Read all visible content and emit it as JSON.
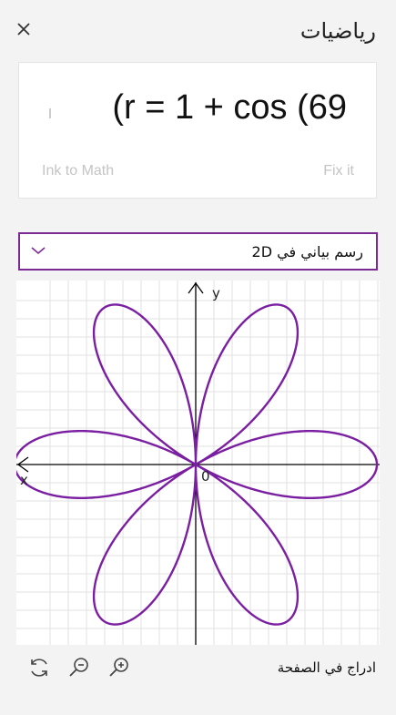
{
  "header": {
    "title": "رياضيات",
    "close_icon": "close-icon"
  },
  "equation": {
    "text": "(r = 1 + cos (69",
    "actions": {
      "fix_it": "Fix it",
      "ink_to_math": "Ink to Math"
    }
  },
  "graph_mode": {
    "selected": "رسم بياني في 2D",
    "chevron_icon": "chevron-down-icon"
  },
  "graph": {
    "y_axis_label": "y",
    "x_axis_label": "x",
    "origin_label": "0",
    "curve_color": "#7b1fa2",
    "petals": 6
  },
  "footer": {
    "insert_label": "ادراج في الصفحة",
    "icons": [
      "refresh-icon",
      "zoom-out-icon",
      "zoom-in-icon"
    ]
  }
}
